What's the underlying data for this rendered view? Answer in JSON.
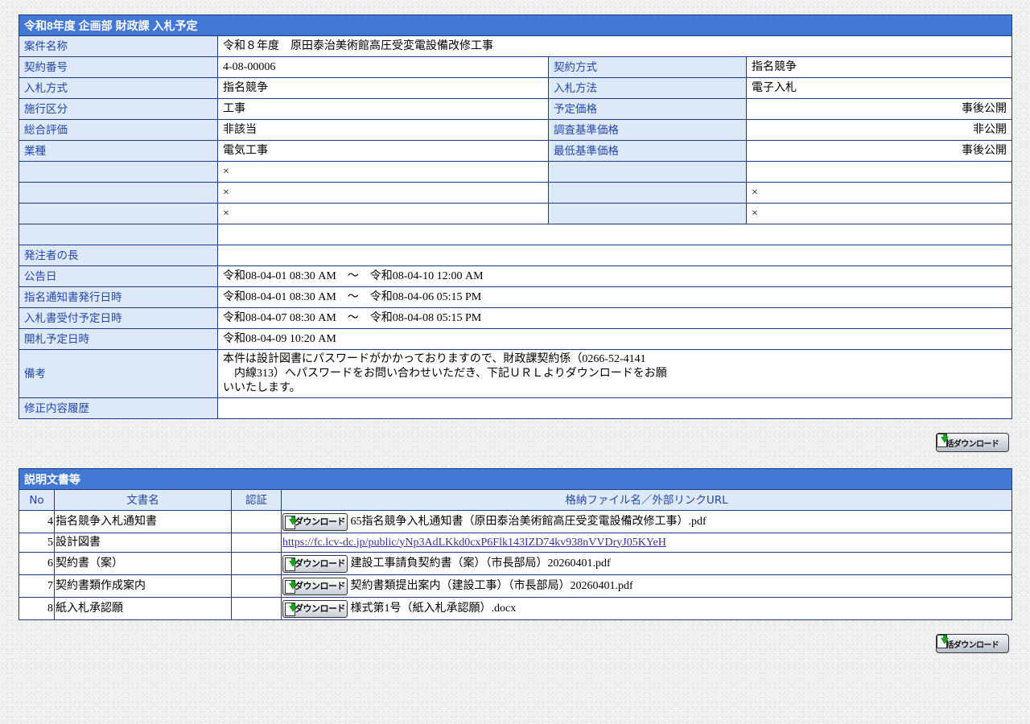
{
  "info": {
    "title": "令和8年度 企画部 財政課 入札予定",
    "labels": {
      "project_name": "案件名称",
      "contract_no": "契約番号",
      "contract_method": "契約方式",
      "bid_type": "入札方式",
      "bid_method": "入札方法",
      "construction_class": "施行区分",
      "planned_price": "予定価格",
      "overall_eval": "総合評価",
      "survey_price": "調査基準価格",
      "industry": "業種",
      "min_price": "最低基準価格",
      "orderer_head": "発注者の長",
      "announce_date": "公告日",
      "nomination_date": "指名通知書発行日時",
      "bid_accept_date": "入札書受付予定日時",
      "opening_date": "開札予定日時",
      "remarks": "備考",
      "revision_history": "修正内容履歴"
    },
    "values": {
      "project_name": "令和８年度　原田泰治美術館高圧受変電設備改修工事",
      "contract_no": "4-08-00006",
      "contract_method": "指名競争",
      "bid_type": "指名競争",
      "bid_method": "電子入札",
      "construction_class": "工事",
      "planned_price": "事後公開",
      "overall_eval": "非該当",
      "survey_price": "非公開",
      "industry": "電気工事",
      "min_price": "事後公開",
      "blank1_left": "×",
      "blank2_left": "×",
      "blank2_right": "×",
      "blank3_left": "×",
      "blank3_right": "×",
      "announce_date": "令和08-04-01 08:30 AM　～　令和08-04-10 12:00 AM",
      "nomination_date": "令和08-04-01 08:30 AM　～　令和08-04-06 05:15 PM",
      "bid_accept_date": "令和08-04-07 08:30 AM　～　令和08-04-08 05:15 PM",
      "opening_date": "令和08-04-09 10:20 AM",
      "remarks_line1": "本件は設計図書にパスワードがかかっておりますので、財政課契約係（0266-52-4141",
      "remarks_line2": "　内線313）へパスワードをお問い合わせいただき、下記ＵＲＬよりダウンロードをお願",
      "remarks_line3": "いいたします。"
    }
  },
  "bulk_download_label": "一括ダウンロード",
  "download_label": "ダウンロード",
  "docs": {
    "title": "説明文書等",
    "headers": {
      "no": "No",
      "name": "文書名",
      "cert": "認証",
      "file": "格納ファイル名／外部リンクURL"
    },
    "rows": [
      {
        "no": "4",
        "name": "指名競争入札通知書",
        "file": "65指名競争入札通知書（原田泰治美術館高圧受変電設備改修工事）.pdf"
      },
      {
        "no": "5",
        "name": "設計図書",
        "link": "https://fc.lcv-dc.jp/public/yNp3AdLKkd0cxP6Flk143IZD74kv938nVVDryJ05KYeH"
      },
      {
        "no": "6",
        "name": "契約書（案）",
        "file": "建設工事請負契約書（案）（市長部局）20260401.pdf"
      },
      {
        "no": "7",
        "name": "契約書類作成案内",
        "file": "契約書類提出案内（建設工事）（市長部局）20260401.pdf"
      },
      {
        "no": "8",
        "name": "紙入札承認願",
        "file": "様式第1号（紙入札承認願）.docx"
      }
    ]
  }
}
